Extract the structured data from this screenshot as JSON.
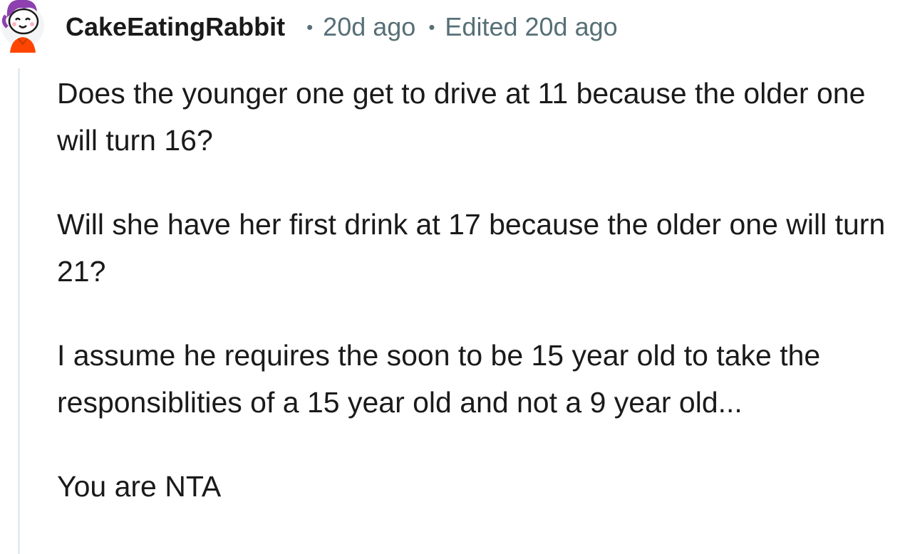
{
  "comment": {
    "author": "CakeEatingRabbit",
    "separator": "•",
    "timestamp": "20d ago",
    "edited": "Edited 20d ago",
    "avatar_icon": "snoo-avatar-icon",
    "paragraphs": [
      "Does the younger one get to drive at 11 because the older one will turn 16?",
      "Will she have her first drink at 17 because the older one will turn 21?",
      "I assume he requires the soon to be 15 year old to take the responsiblities of a 15 year old and not a 9 year old...",
      "You are NTA"
    ]
  },
  "colors": {
    "text": "#1a1a1b",
    "meta": "#576f76",
    "thread_line": "#e5ebee",
    "avatar_hair": "#8e3fb0",
    "avatar_shirt": "#ff4500"
  }
}
